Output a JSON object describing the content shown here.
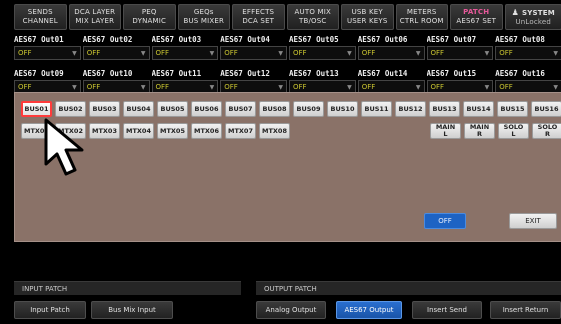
{
  "top_tabs": [
    {
      "line1": "SENDS",
      "line2": "CHANNEL"
    },
    {
      "line1": "DCA LAYER",
      "line2": "MIX LAYER"
    },
    {
      "line1": "PEQ",
      "line2": "DYNAMIC"
    },
    {
      "line1": "GEQs",
      "line2": "BUS MIXER"
    },
    {
      "line1": "EFFECTS",
      "line2": "DCA SET"
    },
    {
      "line1": "AUTO MIX",
      "line2": "TB/OSC"
    },
    {
      "line1": "USB KEY",
      "line2": "USER KEYS"
    },
    {
      "line1": "METERS",
      "line2": "CTRL ROOM"
    },
    {
      "line1": "PATCH",
      "line2": "AES67 SET"
    },
    {
      "line1": "SYSTEM",
      "line2": "UnLocked"
    }
  ],
  "active_tab": "PATCH",
  "channels": [
    {
      "name": "AES67 Out01",
      "value": "OFF"
    },
    {
      "name": "AES67 Out02",
      "value": "OFF"
    },
    {
      "name": "AES67 Out03",
      "value": "OFF"
    },
    {
      "name": "AES67 Out04",
      "value": "OFF"
    },
    {
      "name": "AES67 Out05",
      "value": "OFF"
    },
    {
      "name": "AES67 Out06",
      "value": "OFF"
    },
    {
      "name": "AES67 Out07",
      "value": "OFF"
    },
    {
      "name": "AES67 Out08",
      "value": "OFF"
    },
    {
      "name": "AES67 Out09",
      "value": "OFF"
    },
    {
      "name": "AES67 Out10",
      "value": "OFF"
    },
    {
      "name": "AES67 Out11",
      "value": "OFF"
    },
    {
      "name": "AES67 Out12",
      "value": "OFF"
    },
    {
      "name": "AES67 Out13",
      "value": "OFF"
    },
    {
      "name": "AES67 Out14",
      "value": "OFF"
    },
    {
      "name": "AES67 Out15",
      "value": "OFF"
    },
    {
      "name": "AES67 Out16",
      "value": "OFF"
    }
  ],
  "bus_buttons": [
    "BUS01",
    "BUS02",
    "BUS03",
    "BUS04",
    "BUS05",
    "BUS06",
    "BUS07",
    "BUS08",
    "BUS09",
    "BUS10",
    "BUS11",
    "BUS12",
    "BUS13",
    "BUS14",
    "BUS15",
    "BUS16"
  ],
  "selected_bus": "BUS01",
  "mtx_buttons": [
    "MTX01",
    "MTX02",
    "MTX03",
    "MTX04",
    "MTX05",
    "MTX06",
    "MTX07",
    "MTX08"
  ],
  "main_solo_buttons": [
    {
      "l1": "MAIN",
      "l2": "L"
    },
    {
      "l1": "MAIN",
      "l2": "R"
    },
    {
      "l1": "SOLO",
      "l2": "L"
    },
    {
      "l1": "SOLO",
      "l2": "R"
    }
  ],
  "off_label": "OFF",
  "exit_label": "EXIT",
  "input_patch": {
    "title": "INPUT PATCH",
    "buttons": [
      "Input Patch",
      "Bus Mix Input"
    ]
  },
  "output_patch": {
    "title": "OUTPUT PATCH",
    "buttons": [
      "Analog Output",
      "AES67 Output",
      "Insert Send",
      "Insert Return"
    ],
    "active": "AES67 Output"
  },
  "colors": {
    "panel_bg": "#8a7268",
    "accent_pink": "#e8589a",
    "accent_blue": "#1d63c4",
    "value_yellow": "#c9c430",
    "selection_red": "#ff3b3b"
  }
}
